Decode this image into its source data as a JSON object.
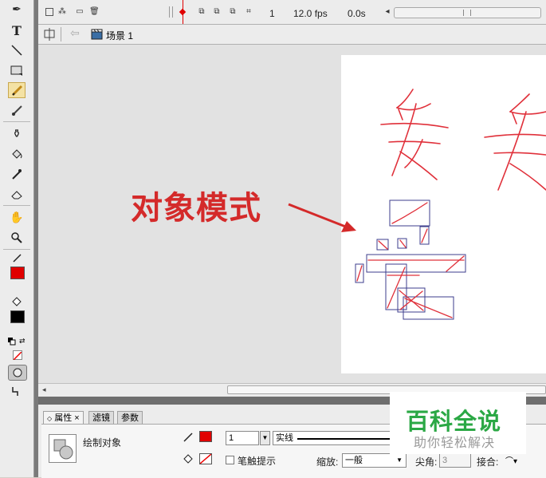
{
  "timeline": {
    "frame": "1",
    "fps": "12.0 fps",
    "time": "0.0s"
  },
  "scene": {
    "label": "场景 1"
  },
  "annotation": {
    "text": "对象模式",
    "color": "#d42a2a"
  },
  "stage": {
    "stroke_color": "#e0303a",
    "box_color": "#3c3c8c"
  },
  "properties": {
    "tabs": [
      "属性",
      "滤镜",
      "参数"
    ],
    "tab_close": "×",
    "object_type": "绘制对象",
    "stroke_size": "1",
    "stroke_style": "实线",
    "stroke_hint": "笔触提示",
    "scale_label": "缩放:",
    "scale_value": "一般",
    "tip_label": "尖角:",
    "tip_value": "3",
    "join_label": "接合:"
  },
  "watermark": {
    "title": "百科全说",
    "subtitle": "助你轻松解决"
  },
  "colors": {
    "stroke": "#e00000",
    "fill": "#000000"
  },
  "icons": [
    "subselect-icon",
    "text-icon",
    "line-icon",
    "rect-icon",
    "pencil-icon",
    "brush-icon",
    "ink-bottle-icon",
    "paint-bucket-icon",
    "eyedropper-icon",
    "eraser-icon",
    "hand-icon",
    "zoom-icon",
    "object-drawing-icon"
  ]
}
